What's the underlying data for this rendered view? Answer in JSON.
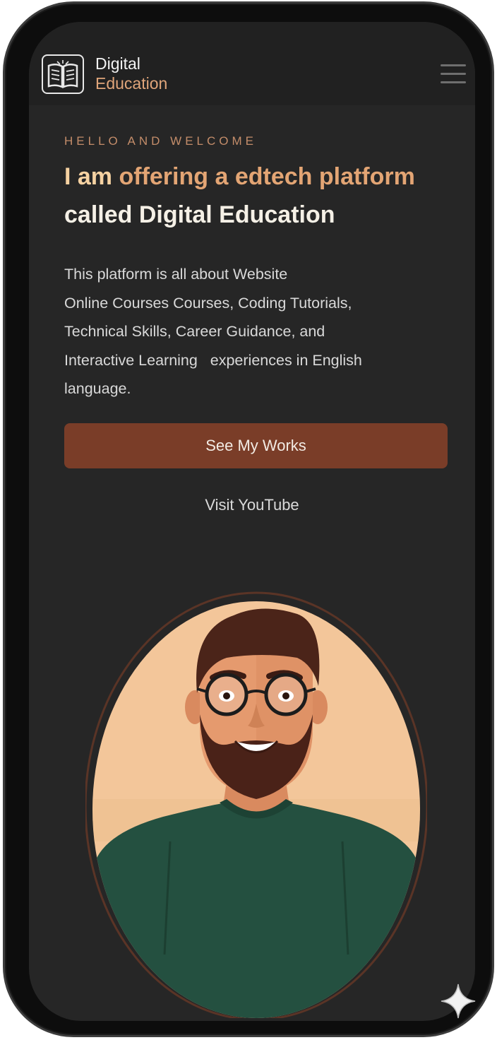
{
  "header": {
    "brand_line1": "Digital",
    "brand_line2": "Education",
    "logo_icon": "open-book-icon",
    "menu_icon": "hamburger-menu-icon"
  },
  "hero": {
    "eyebrow": "HELLO AND WELCOME",
    "headline_lead": "I am ",
    "headline_accent": "offering a edtech platform",
    "headline_rest": "called Digital Education",
    "description_lines": [
      "This platform is all about Website",
      "Online Courses Courses, Coding Tutorials,",
      "Technical Skills, Career Guidance, and",
      "Interactive Learning   experiences in English",
      "language."
    ],
    "primary_button": "See My Works",
    "secondary_link": "Visit YouTube"
  },
  "avatar": {
    "icon": "person-avatar-illustration"
  },
  "colors": {
    "background": "#262626",
    "accent": "#e3a574",
    "button": "#7a3d28",
    "avatar_bg": "#f3c69a",
    "shirt": "#245040"
  },
  "corner_icon": "sparkle-icon"
}
